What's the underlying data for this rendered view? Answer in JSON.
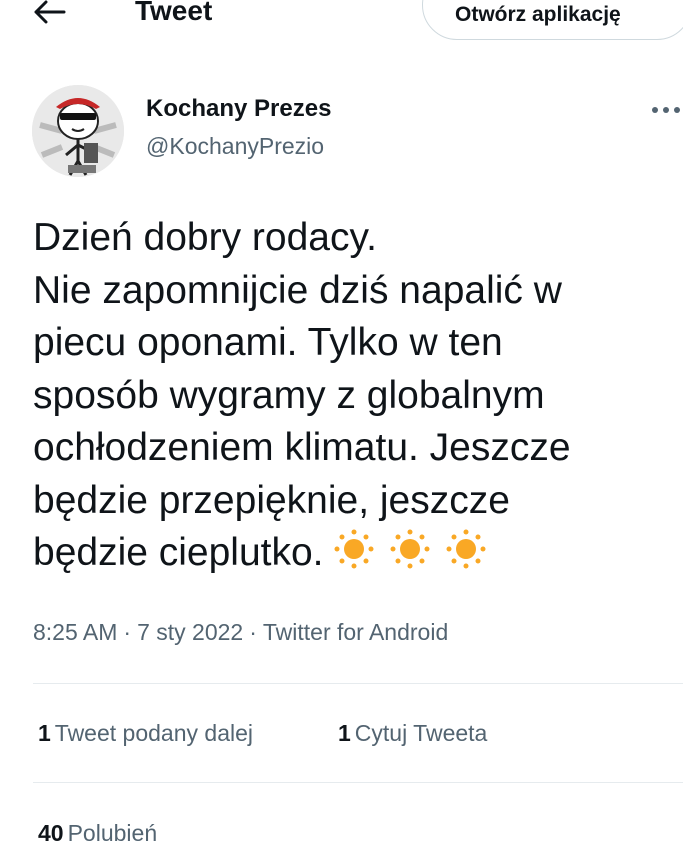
{
  "header": {
    "back_icon": "arrow-left-icon",
    "title": "Tweet",
    "open_app_label": "Otwórz aplikację"
  },
  "author": {
    "name": "Kochany Prezes",
    "handle": "@KochanyPrezio",
    "more_icon": "more-horizontal-icon"
  },
  "tweet": {
    "lines": [
      "Dzień dobry rodacy.",
      "Nie zapomnijcie dziś napalić w",
      "piecu oponami. Tylko w ten",
      "sposób wygramy z globalnym",
      "ochłodzeniem klimatu. Jeszcze",
      "będzie przepięknie, jeszcze",
      "będzie cieplutko."
    ],
    "emoji": [
      "sun-icon",
      "sun-icon",
      "sun-icon"
    ],
    "sun_color": "#f9a825"
  },
  "meta": {
    "time": "8:25 AM",
    "separator": "·",
    "date": "7 sty 2022",
    "source": "Twitter for Android"
  },
  "stats": {
    "retweets_count": "1",
    "retweets_label": "Tweet podany dalej",
    "quotes_count": "1",
    "quotes_label": "Cytuj Tweeta",
    "likes_count": "40",
    "likes_label": "Polubień"
  }
}
